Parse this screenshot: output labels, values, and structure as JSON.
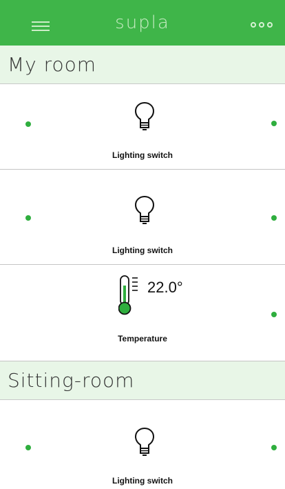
{
  "app_bar": {
    "title": "supla",
    "menu_icon": "hamburger-menu-icon",
    "more_icon": "three-circles-more-icon",
    "color": "#3fb549"
  },
  "sections": [
    {
      "name": "My room",
      "channels": [
        {
          "type": "lighting-switch",
          "label": "Lighting switch",
          "icon": "light-bulb-icon"
        },
        {
          "type": "lighting-switch",
          "label": "Lighting switch",
          "icon": "light-bulb-icon"
        },
        {
          "type": "temperature",
          "label": "Temperature",
          "value": "22.0°",
          "icon": "thermometer-icon"
        }
      ]
    },
    {
      "name": "Sitting-room",
      "channels": [
        {
          "type": "lighting-switch",
          "label": "Lighting switch",
          "icon": "light-bulb-icon"
        }
      ]
    }
  ],
  "status_dot_color": "#2fae3e"
}
